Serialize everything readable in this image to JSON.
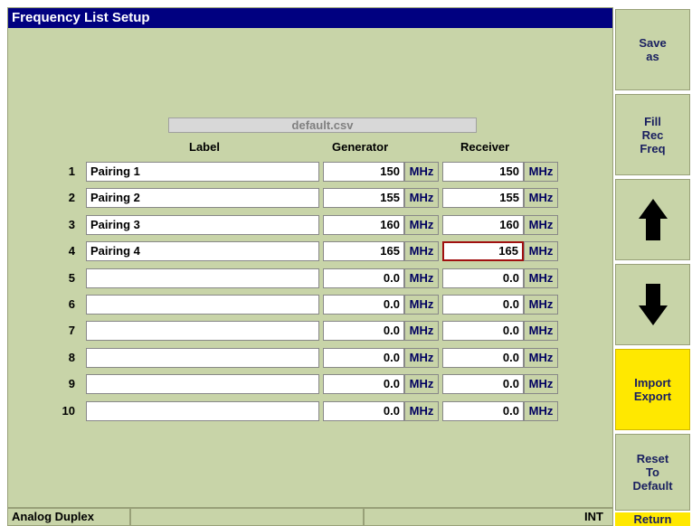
{
  "window": {
    "title": "Frequency List Setup"
  },
  "file": {
    "name": "default.csv"
  },
  "columns": {
    "label": "Label",
    "generator": "Generator",
    "receiver": "Receiver"
  },
  "rows": [
    {
      "num": "1",
      "label": "Pairing 1",
      "gen": "150",
      "gen_unit": "MHz",
      "rec": "150",
      "rec_unit": "MHz"
    },
    {
      "num": "2",
      "label": "Pairing 2",
      "gen": "155",
      "gen_unit": "MHz",
      "rec": "155",
      "rec_unit": "MHz"
    },
    {
      "num": "3",
      "label": "Pairing 3",
      "gen": "160",
      "gen_unit": "MHz",
      "rec": "160",
      "rec_unit": "MHz"
    },
    {
      "num": "4",
      "label": "Pairing 4",
      "gen": "165",
      "gen_unit": "MHz",
      "rec": "165",
      "rec_unit": "MHz"
    },
    {
      "num": "5",
      "label": "",
      "gen": "0.0",
      "gen_unit": "MHz",
      "rec": "0.0",
      "rec_unit": "MHz"
    },
    {
      "num": "6",
      "label": "",
      "gen": "0.0",
      "gen_unit": "MHz",
      "rec": "0.0",
      "rec_unit": "MHz"
    },
    {
      "num": "7",
      "label": "",
      "gen": "0.0",
      "gen_unit": "MHz",
      "rec": "0.0",
      "rec_unit": "MHz"
    },
    {
      "num": "8",
      "label": "",
      "gen": "0.0",
      "gen_unit": "MHz",
      "rec": "0.0",
      "rec_unit": "MHz"
    },
    {
      "num": "9",
      "label": "",
      "gen": "0.0",
      "gen_unit": "MHz",
      "rec": "0.0",
      "rec_unit": "MHz"
    },
    {
      "num": "10",
      "label": "",
      "gen": "0.0",
      "gen_unit": "MHz",
      "rec": "0.0",
      "rec_unit": "MHz"
    }
  ],
  "selected_cell": {
    "row": "4",
    "column": "receiver"
  },
  "status": {
    "mode": "Analog Duplex",
    "ref": "INT"
  },
  "softkeys": {
    "save_as": [
      "Save",
      "as"
    ],
    "fill_rec_freq": [
      "Fill",
      "Rec",
      "Freq"
    ],
    "up_icon": "arrow-up-icon",
    "down_icon": "arrow-down-icon",
    "import_export": [
      "Import",
      "Export"
    ],
    "reset": [
      "Reset",
      "To",
      "Default"
    ],
    "return": "Return"
  },
  "colors": {
    "title_bar": "#000080",
    "panel": "#c8d4a8",
    "active_key": "#ffe800",
    "selected_border": "#a01010"
  }
}
